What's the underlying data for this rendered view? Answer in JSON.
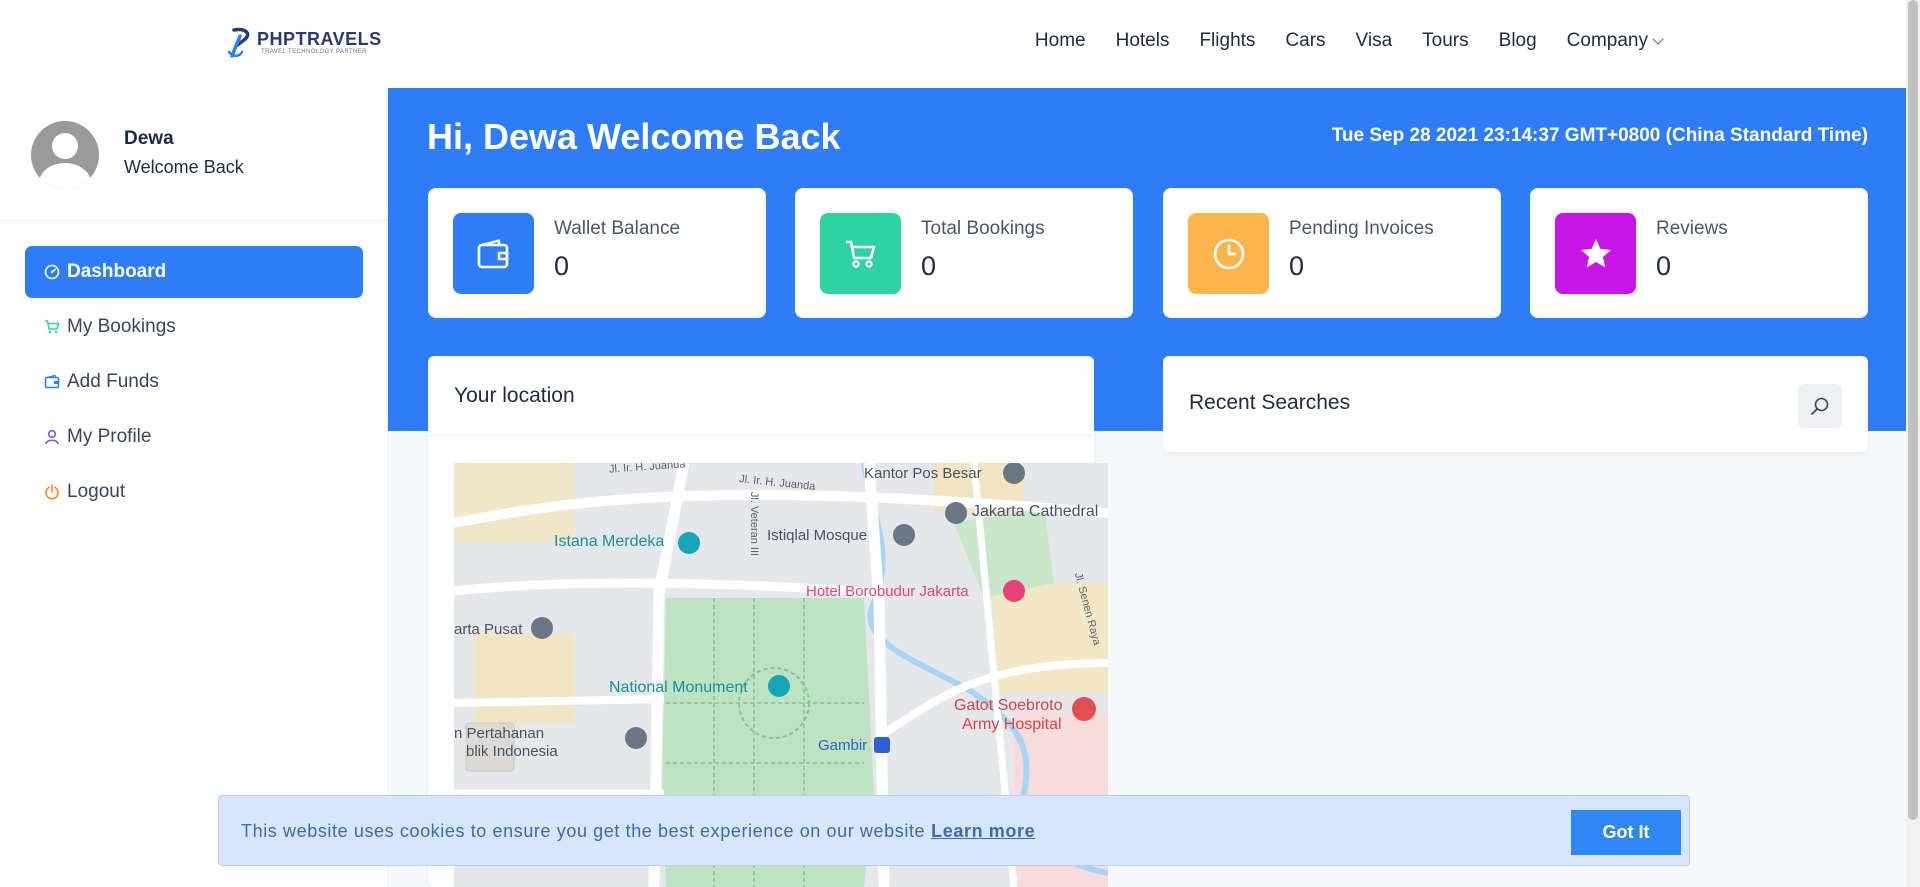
{
  "brand": {
    "name": "PHPTRAVELS",
    "tagline": "TRAVEL TECHNOLOGY PARTNER",
    "accent": "#2f7df6"
  },
  "nav": {
    "items": [
      "Home",
      "Hotels",
      "Flights",
      "Cars",
      "Visa",
      "Tours",
      "Blog"
    ],
    "company": "Company"
  },
  "profile": {
    "name": "Dewa",
    "subtitle": "Welcome Back"
  },
  "sidebar": {
    "items": [
      {
        "label": "Dashboard",
        "icon": "gauge-icon",
        "active": true
      },
      {
        "label": "My Bookings",
        "icon": "cart-icon"
      },
      {
        "label": "Add Funds",
        "icon": "wallet-icon"
      },
      {
        "label": "My Profile",
        "icon": "user-icon"
      },
      {
        "label": "Logout",
        "icon": "power-icon"
      }
    ]
  },
  "hero": {
    "greeting": "Hi, Dewa Welcome Back",
    "datetime": "Tue Sep 28 2021 23:14:37 GMT+0800 (China Standard Time)"
  },
  "stats": [
    {
      "label": "Wallet Balance",
      "value": "0",
      "icon": "wallet-icon",
      "color": "#2f7df6"
    },
    {
      "label": "Total Bookings",
      "value": "0",
      "icon": "cart-icon",
      "color": "#2fd2a3"
    },
    {
      "label": "Pending Invoices",
      "value": "0",
      "icon": "clock-icon",
      "color": "#fbb54c"
    },
    {
      "label": "Reviews",
      "value": "0",
      "icon": "star-icon",
      "color": "#c815e8"
    }
  ],
  "location": {
    "title": "Your location",
    "map": {
      "labels": [
        "Kantor Pos Besar",
        "Jakarta Cathedral",
        "Istana Merdeka",
        "Istiqlal Mosque",
        "Hotel Borobudur Jakarta",
        "arta Pusat",
        "National Monument",
        "Gatot Soebroto",
        "Army Hospital",
        "n Pertahanan",
        "blik Indonesia",
        "Gambir"
      ],
      "streets": [
        "Jl. Ir. H. Juanda",
        "Jl. Ir. H. Juanda",
        "Jl. Veteran III",
        "Jl. Senen Raya"
      ]
    }
  },
  "recent": {
    "title": "Recent Searches"
  },
  "cookie": {
    "text": "This website uses cookies to ensure you get the best experience on our website",
    "link": "Learn more",
    "button": "Got It"
  }
}
